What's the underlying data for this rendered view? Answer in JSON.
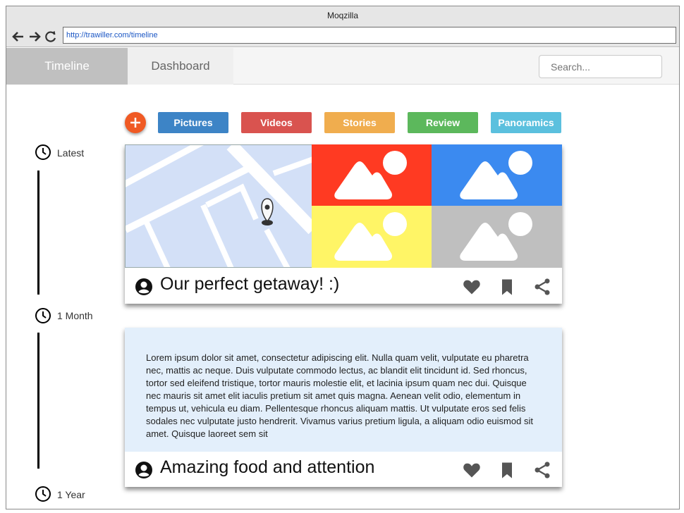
{
  "window": {
    "title": "Moqzilla",
    "url": "http://trawiller.com/timeline"
  },
  "nav": {
    "tabs": [
      {
        "label": "Timeline"
      },
      {
        "label": "Dashboard"
      }
    ],
    "search_placeholder": "Search..."
  },
  "timeline": {
    "markers": [
      {
        "label": "Latest"
      },
      {
        "label": "1 Month"
      },
      {
        "label": "1 Year"
      }
    ]
  },
  "filters": [
    {
      "label": "Pictures",
      "color": "#3d84c6"
    },
    {
      "label": "Videos",
      "color": "#d9534f"
    },
    {
      "label": "Stories",
      "color": "#f0ad4e"
    },
    {
      "label": "Review",
      "color": "#5cb85c"
    },
    {
      "label": "Panoramics",
      "color": "#5bc0de"
    }
  ],
  "posts": [
    {
      "title": "Our perfect getaway! :)",
      "tiles": [
        "#ff3a22",
        "#3b8af0",
        "#fff566",
        "#bfbfbf"
      ]
    },
    {
      "title": "Amazing food and attention",
      "body": "Lorem ipsum dolor sit amet, consectetur adipiscing elit. Nulla quam velit, vulputate eu pharetra nec, mattis ac neque. Duis vulputate commodo lectus, ac blandit elit tincidunt id. Sed rhoncus, tortor sed eleifend tristique, tortor mauris molestie elit, et lacinia ipsum quam nec dui. Quisque nec mauris sit amet elit iaculis pretium sit amet quis magna. Aenean velit odio, elementum in tempus ut, vehicula eu diam. Pellentesque rhoncus aliquam mattis. Ut vulputate eros sed felis sodales nec vulputate justo hendrerit. Vivamus varius pretium ligula, a aliquam odio euismod sit amet. Quisque laoreet sem sit"
    }
  ]
}
